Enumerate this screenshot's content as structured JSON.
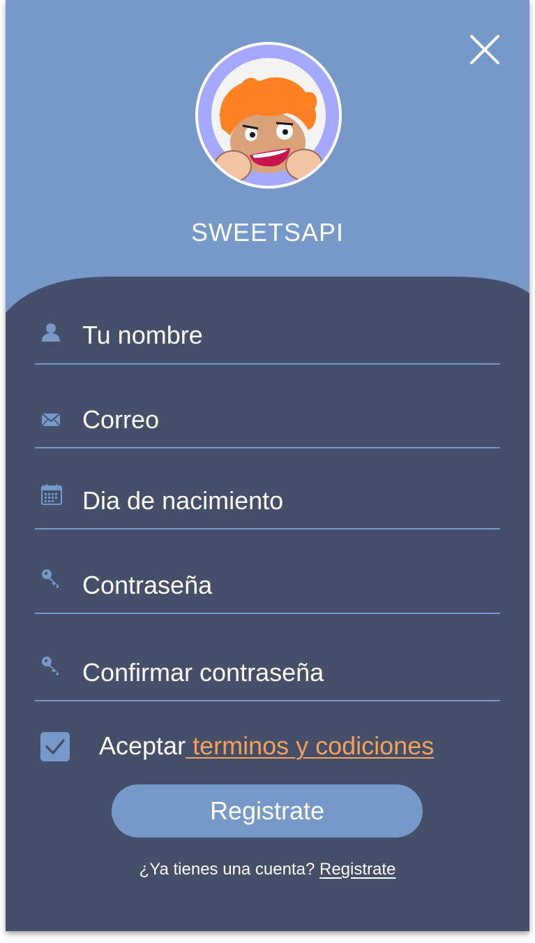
{
  "app": {
    "title": "SWEETSAPI"
  },
  "header": {
    "close_icon": "close-icon",
    "avatar_icon": "avatar-character"
  },
  "form": {
    "fields": [
      {
        "icon": "user-icon",
        "placeholder": "Tu nombre"
      },
      {
        "icon": "mail-icon",
        "placeholder": "Correo"
      },
      {
        "icon": "calendar-icon",
        "placeholder": "Dia de nacimiento"
      },
      {
        "icon": "key-icon",
        "placeholder": "Contraseña"
      },
      {
        "icon": "key-icon",
        "placeholder": "Confirmar contraseña"
      }
    ],
    "terms": {
      "checked": true,
      "prefix": "Aceptar",
      "link": " terminos y codiciones"
    },
    "submit_label": "Registrate"
  },
  "footer": {
    "question": "¿Ya tienes una cuenta? ",
    "link": "Registrate"
  },
  "colors": {
    "primary": "#7799c9",
    "panel": "#464f69",
    "accent": "#f4a259",
    "avatar_ring": "#a4a8ff"
  }
}
